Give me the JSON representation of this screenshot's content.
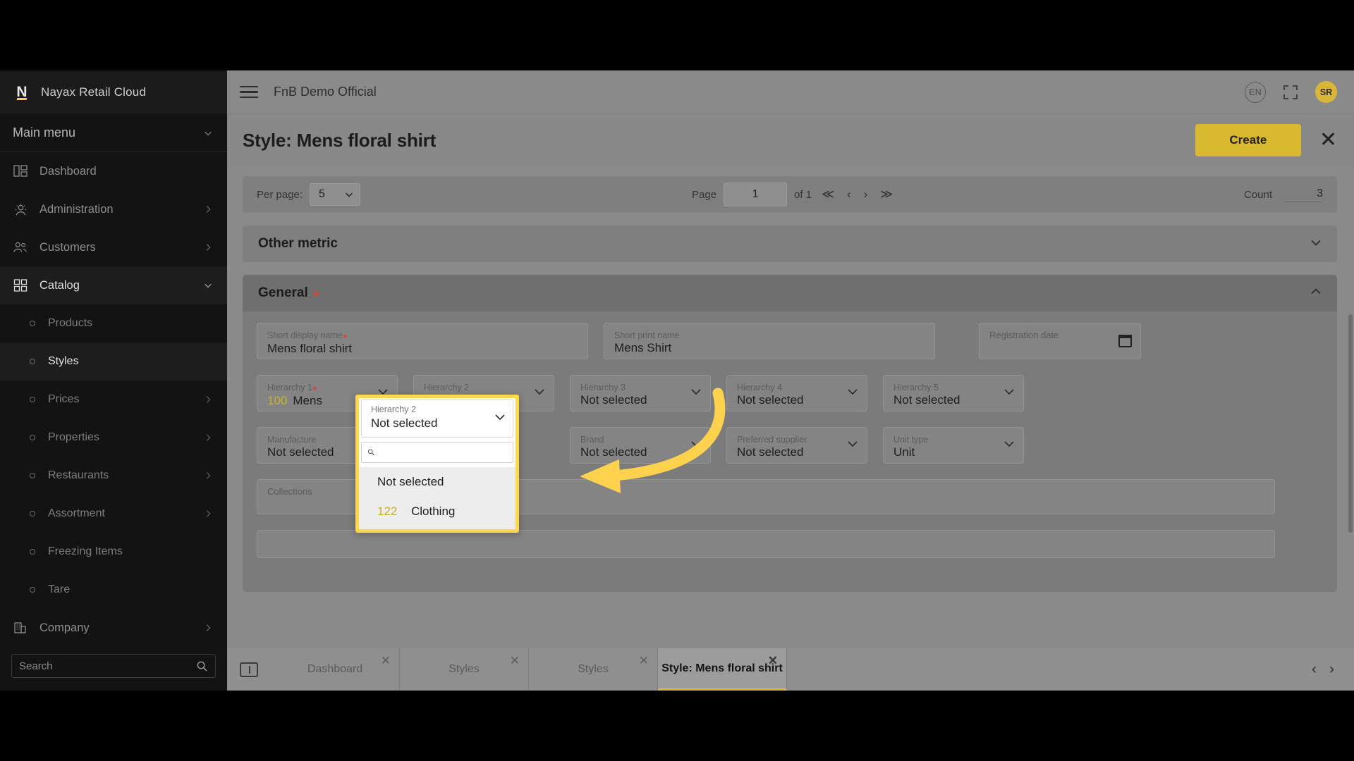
{
  "brand": {
    "name": "Nayax Retail Cloud",
    "logo_letter": "N",
    "logo_icon": "nayax-logo-icon"
  },
  "sidebar": {
    "main_menu_label": "Main menu",
    "items": [
      {
        "label": "Dashboard",
        "icon": "dashboard-icon",
        "expandable": false,
        "active": false
      },
      {
        "label": "Administration",
        "icon": "administration-gear-icon",
        "expandable": true,
        "active": false
      },
      {
        "label": "Customers",
        "icon": "customers-icon",
        "expandable": true,
        "active": false
      },
      {
        "label": "Catalog",
        "icon": "catalog-grid-icon",
        "expandable": true,
        "active": true
      }
    ],
    "catalog_children": [
      {
        "label": "Products",
        "expandable": false,
        "active": false
      },
      {
        "label": "Styles",
        "expandable": false,
        "active": true
      },
      {
        "label": "Prices",
        "expandable": true,
        "active": false
      },
      {
        "label": "Properties",
        "expandable": true,
        "active": false
      },
      {
        "label": "Restaurants",
        "expandable": true,
        "active": false
      },
      {
        "label": "Assortment",
        "expandable": true,
        "active": false
      },
      {
        "label": "Freezing Items",
        "expandable": false,
        "active": false
      },
      {
        "label": "Tare",
        "expandable": false,
        "active": false
      }
    ],
    "company": {
      "label": "Company",
      "icon": "company-building-icon",
      "expandable": true
    },
    "search": {
      "placeholder": "Search",
      "value": "",
      "icon": "search-icon"
    }
  },
  "topbar": {
    "menu_icon": "hamburger-menu-icon",
    "title": "FnB Demo Official",
    "language": "EN",
    "fullscreen_icon": "fullscreen-icon",
    "avatar_initials": "SR"
  },
  "page": {
    "title": "Style: Mens floral shirt",
    "create_label": "Create",
    "close_icon": "close-icon"
  },
  "pager": {
    "per_page_label": "Per page:",
    "per_page_value": "5",
    "page_label": "Page",
    "page_value": "1",
    "of_label": "of 1",
    "first_icon": "≪",
    "prev_icon": "‹",
    "next_icon": "›",
    "last_icon": "≫",
    "count_label": "Count",
    "count_value": "3"
  },
  "sections": {
    "other_metric": {
      "title": "Other metric",
      "collapsed": true,
      "caret": "chevron-down-icon"
    },
    "general": {
      "title": "General",
      "required": true,
      "collapsed": false,
      "caret": "chevron-up-icon"
    }
  },
  "form": {
    "row1": [
      {
        "label": "Short display name",
        "required": true,
        "value": "Mens floral shirt",
        "type": "text"
      },
      {
        "label": "Short print name",
        "required": false,
        "value": "Mens Shirt",
        "type": "text"
      },
      {
        "label": "Registration date",
        "required": false,
        "value": "",
        "type": "date",
        "icon": "calendar-icon"
      }
    ],
    "row2": [
      {
        "label": "Hierarchy 1",
        "required": true,
        "code": "100",
        "value": "Mens",
        "type": "select"
      },
      {
        "label": "Hierarchy 2",
        "required": false,
        "code": "",
        "value": "Not selected",
        "type": "select"
      },
      {
        "label": "Hierarchy 3",
        "required": false,
        "code": "",
        "value": "Not selected",
        "type": "select"
      },
      {
        "label": "Hierarchy 4",
        "required": false,
        "code": "",
        "value": "Not selected",
        "type": "select"
      },
      {
        "label": "Hierarchy 5",
        "required": false,
        "code": "",
        "value": "Not selected",
        "type": "select"
      }
    ],
    "row3": [
      {
        "label": "Manufacture",
        "required": false,
        "value": "Not selected",
        "type": "select"
      },
      {
        "label": "Brand",
        "required": false,
        "value": "Not selected",
        "type": "select"
      },
      {
        "label": "Preferred supplier",
        "required": false,
        "value": "Not selected",
        "type": "select"
      },
      {
        "label": "Unit type",
        "required": false,
        "value": "Unit",
        "type": "select"
      }
    ],
    "row4": [
      {
        "label": "Collections",
        "required": false,
        "value": "",
        "type": "text"
      }
    ]
  },
  "dropdown": {
    "field_label": "Hierarchy 2",
    "field_value": "Not selected",
    "caret": "chevron-down-icon",
    "search": {
      "placeholder": "",
      "value": "",
      "icon": "search-icon"
    },
    "options": [
      {
        "code": "",
        "label": "Not selected"
      },
      {
        "code": "122",
        "label": "Clothing"
      }
    ]
  },
  "annotation": {
    "arrow_color": "#FFD24D",
    "highlight_color": "#FFD84D"
  },
  "taskbar": {
    "window_icon": "window-icon",
    "tabs": [
      {
        "label": "Dashboard",
        "active": false,
        "close_icon": "close-icon"
      },
      {
        "label": "Styles",
        "active": false,
        "close_icon": "close-icon"
      },
      {
        "label": "Styles",
        "active": false,
        "close_icon": "close-icon"
      },
      {
        "label": "Style: Mens floral shirt",
        "active": true,
        "close_icon": "close-icon"
      }
    ],
    "prev_icon": "‹",
    "next_icon": "›"
  }
}
